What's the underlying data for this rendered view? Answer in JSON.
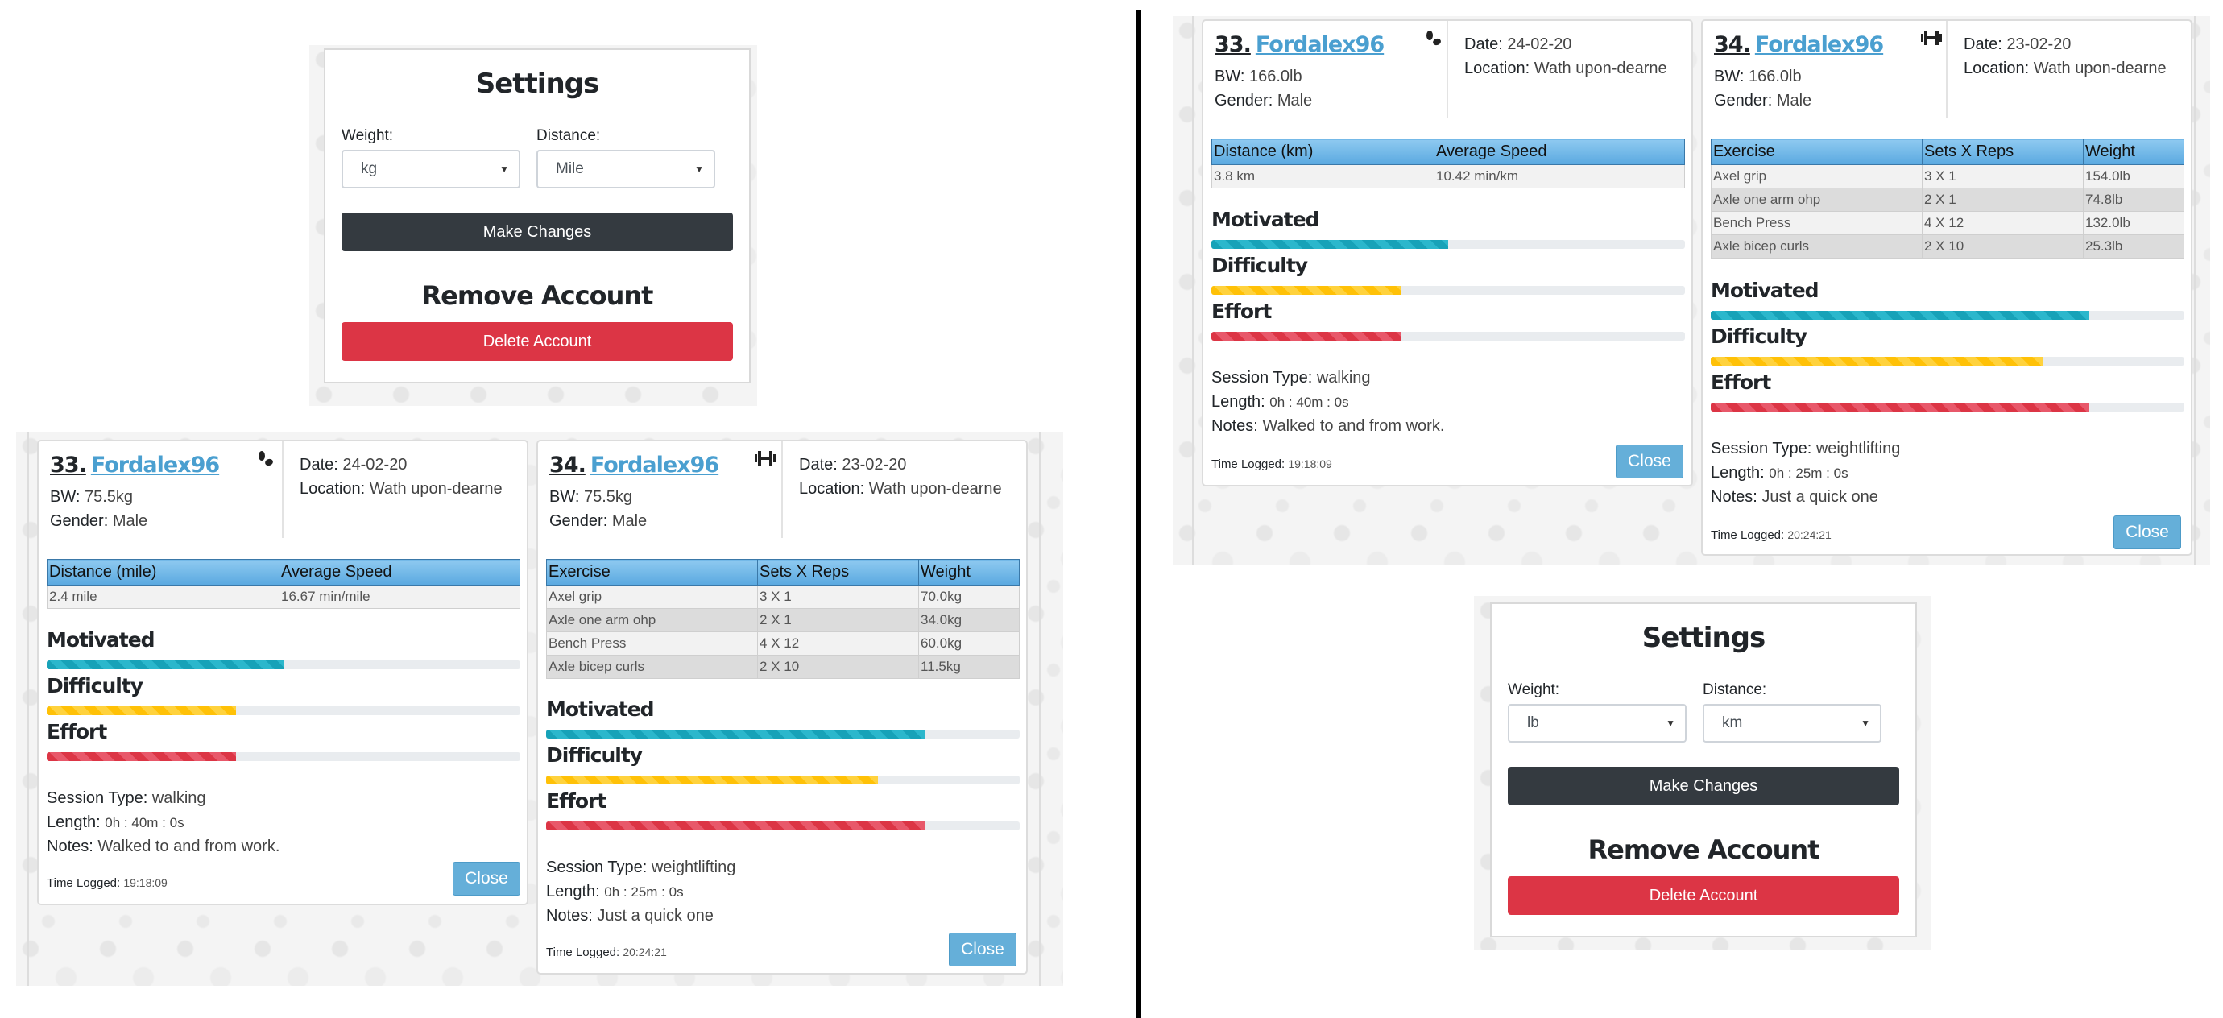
{
  "settings": {
    "title": "Settings",
    "weight_label": "Weight:",
    "distance_label": "Distance:",
    "make_changes": "Make Changes",
    "remove_title": "Remove Account",
    "delete_button": "Delete Account"
  },
  "left_settings": {
    "weight_value": "kg",
    "distance_value": "Mile"
  },
  "right_settings": {
    "weight_value": "lb",
    "distance_value": "km"
  },
  "labels": {
    "bw": "BW:",
    "gender": "Gender:",
    "date": "Date:",
    "location": "Location:",
    "motivated": "Motivated",
    "difficulty": "Difficulty",
    "effort": "Effort",
    "session_type": "Session Type:",
    "length": "Length:",
    "notes": "Notes:",
    "time_logged": "Time Logged:",
    "close": "Close"
  },
  "walking_log": {
    "number": "33.",
    "username": "Fordalex96",
    "icon": "footprints-icon",
    "gender": "Male",
    "date": "24-02-20",
    "location": "Wath upon-dearne",
    "motivated": 0.5,
    "difficulty": 0.4,
    "effort": 0.4,
    "session_type": "walking",
    "length": "0h : 40m : 0s",
    "notes": "Walked to and from work.",
    "time_logged": "19:18:09"
  },
  "weights_log": {
    "number": "34.",
    "username": "Fordalex96",
    "icon": "dumbbell-icon",
    "gender": "Male",
    "date": "23-02-20",
    "location": "Wath upon-dearne",
    "motivated": 0.8,
    "difficulty": 0.7,
    "effort": 0.8,
    "session_type": "weightlifting",
    "length": "0h : 25m : 0s",
    "notes": "Just a quick one",
    "time_logged": "20:24:21",
    "headers": [
      "Exercise",
      "Sets X Reps",
      "Weight"
    ]
  },
  "left_walking": {
    "bw": "75.5kg",
    "headers": [
      "Distance (mile)",
      "Average Speed"
    ],
    "row": [
      "2.4 mile",
      "16.67 min/mile"
    ]
  },
  "right_walking": {
    "bw": "166.0lb",
    "headers": [
      "Distance (km)",
      "Average Speed"
    ],
    "row": [
      "3.8 km",
      "10.42 min/km"
    ]
  },
  "left_weights": {
    "bw": "75.5kg",
    "rows": [
      [
        "Axel grip",
        "3 X 1",
        "70.0kg"
      ],
      [
        "Axle one arm ohp",
        "2 X 1",
        "34.0kg"
      ],
      [
        "Bench Press",
        "4 X 12",
        "60.0kg"
      ],
      [
        "Axle bicep curls",
        "2 X 10",
        "11.5kg"
      ]
    ]
  },
  "right_weights": {
    "bw": "166.0lb",
    "rows": [
      [
        "Axel grip",
        "3 X 1",
        "154.0lb"
      ],
      [
        "Axle one arm ohp",
        "2 X 1",
        "74.8lb"
      ],
      [
        "Bench Press",
        "4 X 12",
        "132.0lb"
      ],
      [
        "Axle bicep curls",
        "2 X 10",
        "25.3lb"
      ]
    ]
  }
}
